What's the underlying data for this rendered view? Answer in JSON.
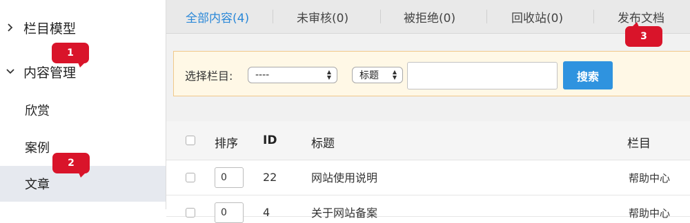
{
  "sidebar": {
    "group1": {
      "label": "栏目模型",
      "icon": "chevron-right-icon"
    },
    "group2": {
      "label": "内容管理",
      "icon": "chevron-down-icon"
    },
    "items": [
      {
        "label": "欣赏"
      },
      {
        "label": "案例"
      },
      {
        "label": "文章"
      }
    ]
  },
  "badges": [
    "1",
    "2",
    "3"
  ],
  "tabs": [
    {
      "label": "全部内容(4)",
      "active": true
    },
    {
      "label": "未审核(0)"
    },
    {
      "label": "被拒绝(0)"
    },
    {
      "label": "回收站(0)"
    },
    {
      "label": "发布文档"
    }
  ],
  "search": {
    "label": "选择栏目:",
    "category_value": "----",
    "field_value": "标题",
    "keyword_value": "",
    "button_label": "搜索"
  },
  "table": {
    "headers": {
      "sort": "排序",
      "id": "ID",
      "title": "标题",
      "column": "栏目"
    },
    "rows": [
      {
        "sort": "0",
        "id": "22",
        "title": "网站使用说明",
        "column": "帮助中心"
      },
      {
        "sort": "0",
        "id": "4",
        "title": "关于网站备案",
        "column": "帮助中心"
      }
    ]
  },
  "colors": {
    "accent": "#2b88d8",
    "badge": "#d9142a",
    "search_button": "#2f93df",
    "search_bar_bg": "#fff8e6"
  }
}
